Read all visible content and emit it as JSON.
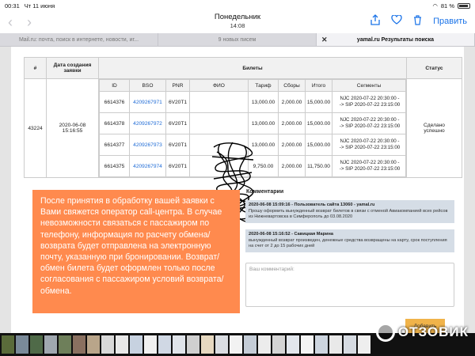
{
  "status_bar": {
    "time": "00:31",
    "date": "Чт 11 июня",
    "battery": "81 %"
  },
  "toolbar": {
    "title": "Понедельник",
    "subtitle": "14:08",
    "edit_label": "Править"
  },
  "tabs": [
    {
      "label": "Mail.ru: почта, поиск в интернете, новости, иг..."
    },
    {
      "label": "9 новых писем"
    },
    {
      "label": "yamal.ru Результаты поиска"
    }
  ],
  "table": {
    "headers": {
      "num": "#",
      "created": "Дата создания заявки",
      "tickets": "Билеты",
      "status": "Статус"
    },
    "sub_headers": [
      "ID",
      "BSO",
      "PNR",
      "ФИО",
      "Тариф",
      "Сборы",
      "Итого",
      "Сегменты"
    ],
    "order_num": "43224",
    "created_date": "2020-06-08",
    "created_time": "15:16:55",
    "status_line1": "Сделано",
    "status_line2": "успешно",
    "rows": [
      {
        "id": "6614376",
        "bso": "4209267971",
        "pnr": "6V20T1",
        "fio": "",
        "tariff": "13,000.00",
        "fees": "2,000.00",
        "total": "15,000.00",
        "seg1": "NJC 2020-07-22 20:30:00 -",
        "seg2": "-> SIP 2020-07-22 23:15:00"
      },
      {
        "id": "6614378",
        "bso": "4209267972",
        "pnr": "6V20T1",
        "fio": "",
        "tariff": "13,000.00",
        "fees": "2,000.00",
        "total": "15,000.00",
        "seg1": "NJC 2020-07-22 20:30:00 -",
        "seg2": "-> SIP 2020-07-22 23:15:00"
      },
      {
        "id": "6614377",
        "bso": "4209267973",
        "pnr": "6V20T1",
        "fio": "",
        "tariff": "13,000.00",
        "fees": "2,000.00",
        "total": "15,000.00",
        "seg1": "NJC 2020-07-22 20:30:00 -",
        "seg2": "-> SIP 2020-07-22 23:15:00"
      },
      {
        "id": "6614375",
        "bso": "4209267974",
        "pnr": "6V20T1",
        "fio": "",
        "tariff": "9,750.00",
        "fees": "2,000.00",
        "total": "11,750.00",
        "seg1": "NJC 2020-07-22 20:30:00 -",
        "seg2": "-> SIP 2020-07-22 23:15:00"
      }
    ]
  },
  "note": {
    "text": "После принятия в обработку вашей заявки с Вами свяжется оператор call-центра. В случае невозможности связаться с пассажиром по телефону, информация по расчету обмена/возврата будет отправлена на электронную почту, указанную при бронировании. Возврат/обмен билета будет оформлен только после согласования с пассажиром условий возврата/обмена."
  },
  "comments": {
    "title": "Комментарии",
    "items": [
      {
        "head": "2020-06-08 15:09:16 - Пользователь сайта 13060 - yamal.ru",
        "body": "Прошу оформить вынужденный возврат билетов в связи с отменой Авиакомпанией всех рейсов из Нижневартовска в Симферополь до 03.08.2020"
      },
      {
        "head": "2020-06-08 15:16:52 - Савицкая Марина",
        "body": "вынужденный возврат произведен, денежные средства возвращены на карту, срок поступления на счет от 2 до 15 рабочих дней"
      }
    ],
    "placeholder": "Ваш комментарий:",
    "add_label": "Добавить"
  },
  "watermark": "ОТЗОВИК"
}
